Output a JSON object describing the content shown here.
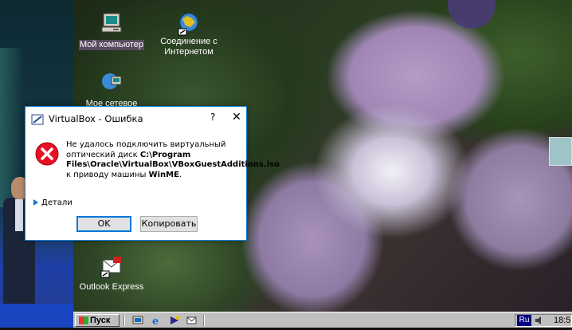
{
  "desktop": {
    "icons": [
      {
        "label": "Мой компьютер",
        "icon": "my-computer-icon"
      },
      {
        "label": "Соединение с Интернетом",
        "icon": "internet-connection-icon"
      },
      {
        "label": "Мое сетевое",
        "icon": "network-icon"
      },
      {
        "label": "Outlook Express",
        "icon": "outlook-express-icon"
      }
    ]
  },
  "dialog": {
    "title": "VirtualBox - Ошибка",
    "help": "?",
    "close": "✕",
    "message_prefix": "Не удалось подключить виртуальный оптический диск ",
    "message_path": "C:\\Program Files\\Oracle\\VirtualBox\\VBoxGuestAdditions.iso",
    "message_mid": " к приводу машины ",
    "message_vm": "WinME",
    "message_suffix": ".",
    "details_label": "Детали",
    "ok_label": "OK",
    "copy_label": "Копировать"
  },
  "taskbar": {
    "start_label": "Пуск",
    "lang": "Ru",
    "clock": "18:5"
  },
  "colors": {
    "dialog_border": "#1883d7",
    "ok_border": "#0078d7",
    "error_red": "#e81123",
    "taskbar": "#c0c0c0"
  }
}
